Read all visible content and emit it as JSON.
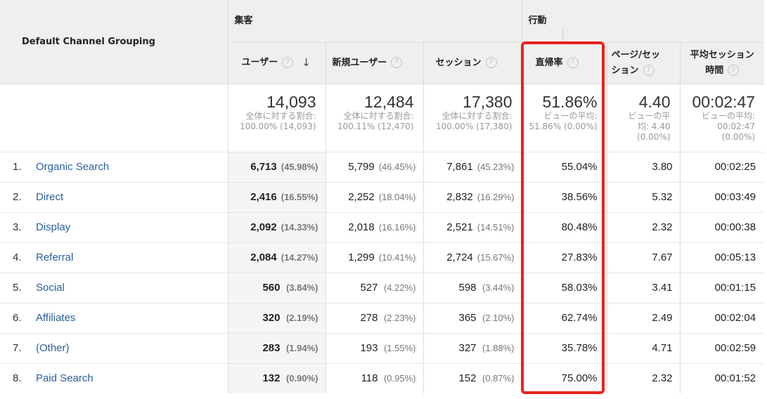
{
  "header": {
    "dimension": "Default Channel Grouping",
    "group_acquisition": "集客",
    "group_behavior": "行動",
    "col_users": "ユーザー",
    "col_new_users": "新規ユーザー",
    "col_sessions": "セッション",
    "col_bounce": "直帰率",
    "col_pages_line1": "ページ/セッ",
    "col_pages_line2": "ション",
    "col_duration_line1": "平均セッション",
    "col_duration_line2": "時間",
    "help_glyph": "?",
    "sort_glyph": "↓"
  },
  "summary": {
    "users": {
      "value": "14,093",
      "l1": "全体に対する割合:",
      "l2": "100.00% (14,093)"
    },
    "new_users": {
      "value": "12,484",
      "l1": "全体に対する割合:",
      "l2": "100.11% (12,470)"
    },
    "sessions": {
      "value": "17,380",
      "l1": "全体に対する割合:",
      "l2": "100.00% (17,380)"
    },
    "bounce": {
      "value": "51.86%",
      "l1": "ビューの平均:",
      "l2": "51.86% (0.00%)"
    },
    "pages": {
      "value": "4.40",
      "l1": "ビューの平",
      "l2": "均: 4.40",
      "l3": "(0.00%)"
    },
    "duration": {
      "value": "00:02:47",
      "l1": "ビューの平均:",
      "l2": "00:02:47",
      "l3": "(0.00%)"
    }
  },
  "rows": [
    {
      "rank": "1.",
      "channel": "Organic Search",
      "users": "6,713",
      "users_pct": "(45.98%)",
      "new_users": "5,799",
      "new_users_pct": "(46.45%)",
      "sessions": "7,861",
      "sessions_pct": "(45.23%)",
      "bounce": "55.04%",
      "pages": "3.80",
      "duration": "00:02:25"
    },
    {
      "rank": "2.",
      "channel": "Direct",
      "users": "2,416",
      "users_pct": "(16.55%)",
      "new_users": "2,252",
      "new_users_pct": "(18.04%)",
      "sessions": "2,832",
      "sessions_pct": "(16.29%)",
      "bounce": "38.56%",
      "pages": "5.32",
      "duration": "00:03:49"
    },
    {
      "rank": "3.",
      "channel": "Display",
      "users": "2,092",
      "users_pct": "(14.33%)",
      "new_users": "2,018",
      "new_users_pct": "(16.16%)",
      "sessions": "2,521",
      "sessions_pct": "(14.51%)",
      "bounce": "80.48%",
      "pages": "2.32",
      "duration": "00:00:38"
    },
    {
      "rank": "4.",
      "channel": "Referral",
      "users": "2,084",
      "users_pct": "(14.27%)",
      "new_users": "1,299",
      "new_users_pct": "(10.41%)",
      "sessions": "2,724",
      "sessions_pct": "(15.67%)",
      "bounce": "27.83%",
      "pages": "7.67",
      "duration": "00:05:13"
    },
    {
      "rank": "5.",
      "channel": "Social",
      "users": "560",
      "users_pct": "(3.84%)",
      "new_users": "527",
      "new_users_pct": "(4.22%)",
      "sessions": "598",
      "sessions_pct": "(3.44%)",
      "bounce": "58.03%",
      "pages": "3.41",
      "duration": "00:01:15"
    },
    {
      "rank": "6.",
      "channel": "Affiliates",
      "users": "320",
      "users_pct": "(2.19%)",
      "new_users": "278",
      "new_users_pct": "(2.23%)",
      "sessions": "365",
      "sessions_pct": "(2.10%)",
      "bounce": "62.74%",
      "pages": "2.49",
      "duration": "00:02:04"
    },
    {
      "rank": "7.",
      "channel": "(Other)",
      "users": "283",
      "users_pct": "(1.94%)",
      "new_users": "193",
      "new_users_pct": "(1.55%)",
      "sessions": "327",
      "sessions_pct": "(1.88%)",
      "bounce": "35.78%",
      "pages": "4.71",
      "duration": "00:02:59"
    },
    {
      "rank": "8.",
      "channel": "Paid Search",
      "users": "132",
      "users_pct": "(0.90%)",
      "new_users": "118",
      "new_users_pct": "(0.95%)",
      "sessions": "152",
      "sessions_pct": "(0.87%)",
      "bounce": "75.00%",
      "pages": "2.32",
      "duration": "00:01:52"
    }
  ],
  "colors": {
    "link": "#2a5fa0",
    "highlight": "#e8231f",
    "header_bg": "#efefef"
  }
}
